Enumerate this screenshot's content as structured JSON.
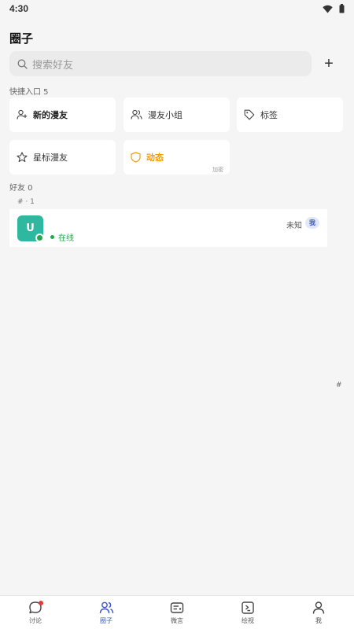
{
  "status_bar": {
    "time": "4:30",
    "icons": [
      "wifi-icon",
      "battery-icon"
    ]
  },
  "page": {
    "title": "圈子"
  },
  "search": {
    "placeholder": "搜索好友",
    "add_symbol": "+"
  },
  "shortcuts": {
    "header": "快捷入口 5",
    "items": [
      {
        "label": "新的漫友",
        "icon": "add-user-icon"
      },
      {
        "label": "漫友小组",
        "icon": "group-icon"
      },
      {
        "label": "标签",
        "icon": "tag-icon"
      },
      {
        "label": "星标漫友",
        "icon": "star-icon"
      },
      {
        "label": "动态",
        "icon": "shield-icon",
        "tag": "加密"
      }
    ]
  },
  "friends": {
    "header": "好友 0",
    "index_header": "# · 1",
    "list": [
      {
        "avatar_letter": "U",
        "status": "在线",
        "location": "未知",
        "badge": "我"
      }
    ],
    "side_index": "#"
  },
  "bottom_nav": {
    "items": [
      {
        "label": "讨论",
        "icon": "chat-bubble-icon",
        "has_badge": true
      },
      {
        "label": "圈子",
        "icon": "users-icon",
        "active": true
      },
      {
        "label": "微言",
        "icon": "message-card-icon"
      },
      {
        "label": "绘视",
        "icon": "video-icon"
      },
      {
        "label": "我",
        "icon": "user-icon"
      }
    ]
  },
  "colors": {
    "accent": "#3b57c4",
    "online": "#22a94c",
    "orange": "#f29c07",
    "avatar": "#2fb8a0",
    "badge_red": "#e53935"
  }
}
